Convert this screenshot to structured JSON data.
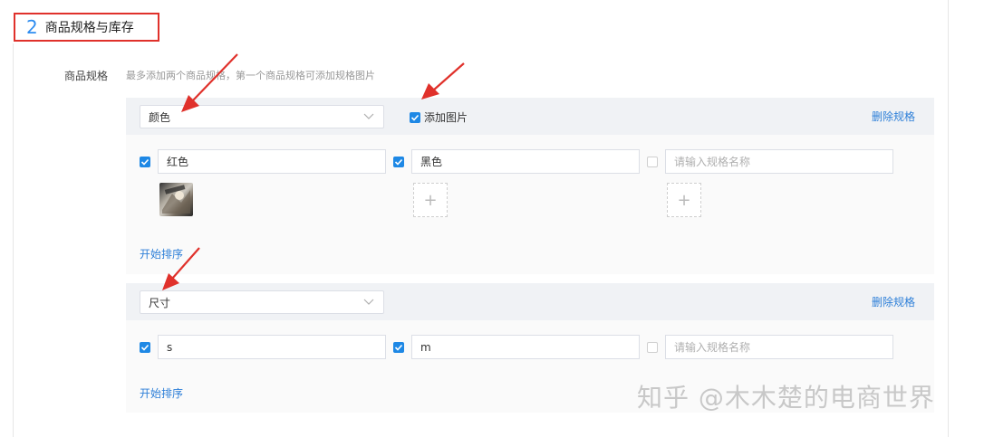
{
  "section": {
    "number": "2",
    "title": "商品规格与库存"
  },
  "spec": {
    "label": "商品规格",
    "hint": "最多添加两个商品规格，第一个商品规格可添加规格图片"
  },
  "groups": [
    {
      "name": "颜色",
      "add_image_label": "添加图片",
      "add_image_checked": true,
      "delete_label": "删除规格",
      "values": [
        {
          "text": "红色",
          "checked": true
        },
        {
          "text": "黑色",
          "checked": true
        },
        {
          "placeholder": "请输入规格名称",
          "checked": false
        }
      ],
      "sort_label": "开始排序",
      "plus_symbol": "+"
    },
    {
      "name": "尺寸",
      "delete_label": "删除规格",
      "values": [
        {
          "text": "s",
          "checked": true
        },
        {
          "text": "m",
          "checked": true
        },
        {
          "placeholder": "请输入规格名称",
          "checked": false
        }
      ],
      "sort_label": "开始排序"
    }
  ],
  "watermark": "知乎 @木木楚的电商世界",
  "colors": {
    "accent": "#1e88e5",
    "link": "#2d7fd8",
    "annotation_red": "#e0312b"
  }
}
